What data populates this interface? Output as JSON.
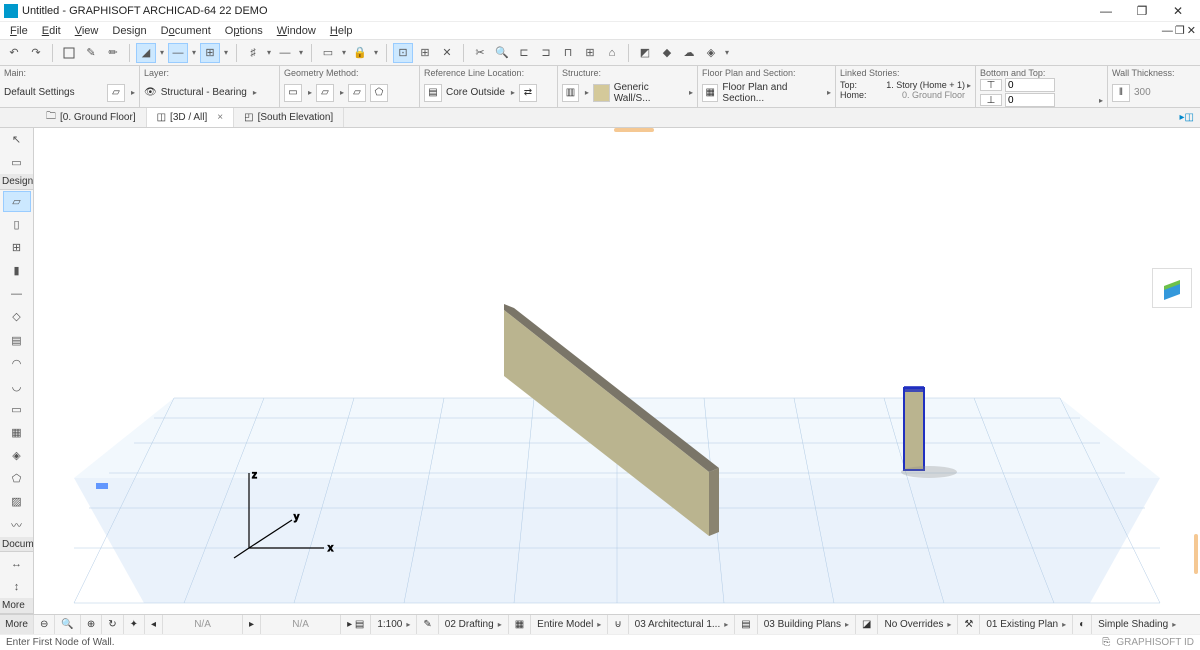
{
  "title": "Untitled - GRAPHISOFT ARCHICAD-64 22 DEMO",
  "menu": [
    "File",
    "Edit",
    "View",
    "Design",
    "Document",
    "Options",
    "Window",
    "Help"
  ],
  "opts": {
    "main": {
      "label": "Main:",
      "val": "Default Settings"
    },
    "layer": {
      "label": "Layer:",
      "val": "Structural - Bearing"
    },
    "geom": {
      "label": "Geometry Method:"
    },
    "refline": {
      "label": "Reference Line Location:",
      "val": "Core Outside"
    },
    "structure": {
      "label": "Structure:",
      "val": "Generic Wall/S..."
    },
    "fps": {
      "label": "Floor Plan and Section:",
      "val": "Floor Plan and Section..."
    },
    "linked": {
      "label": "Linked Stories:",
      "top": "Top:",
      "topval": "1. Story (Home + 1)",
      "home": "Home:",
      "homeval": "0. Ground Floor"
    },
    "bt": {
      "label": "Bottom and Top:",
      "v1": "0",
      "v2": "0"
    },
    "wt": {
      "label": "Wall Thickness:",
      "val": "300"
    }
  },
  "tabs": [
    {
      "label": "[0. Ground Floor]"
    },
    {
      "label": "[3D / All]",
      "close": true
    },
    {
      "label": "[South Elevation]"
    }
  ],
  "left": {
    "design": "Design",
    "docu": "Docume",
    "more": "More"
  },
  "bottom": {
    "na": "N/A",
    "scale": "1:100",
    "drafting": "02 Drafting",
    "model": "Entire Model",
    "arch": "03 Architectural 1...",
    "plans": "03 Building Plans",
    "nov": "No Overrides",
    "exist": "01 Existing Plan",
    "shade": "Simple Shading"
  },
  "hint": "Enter First Node of Wall.",
  "gid": "GRAPHISOFT ID"
}
